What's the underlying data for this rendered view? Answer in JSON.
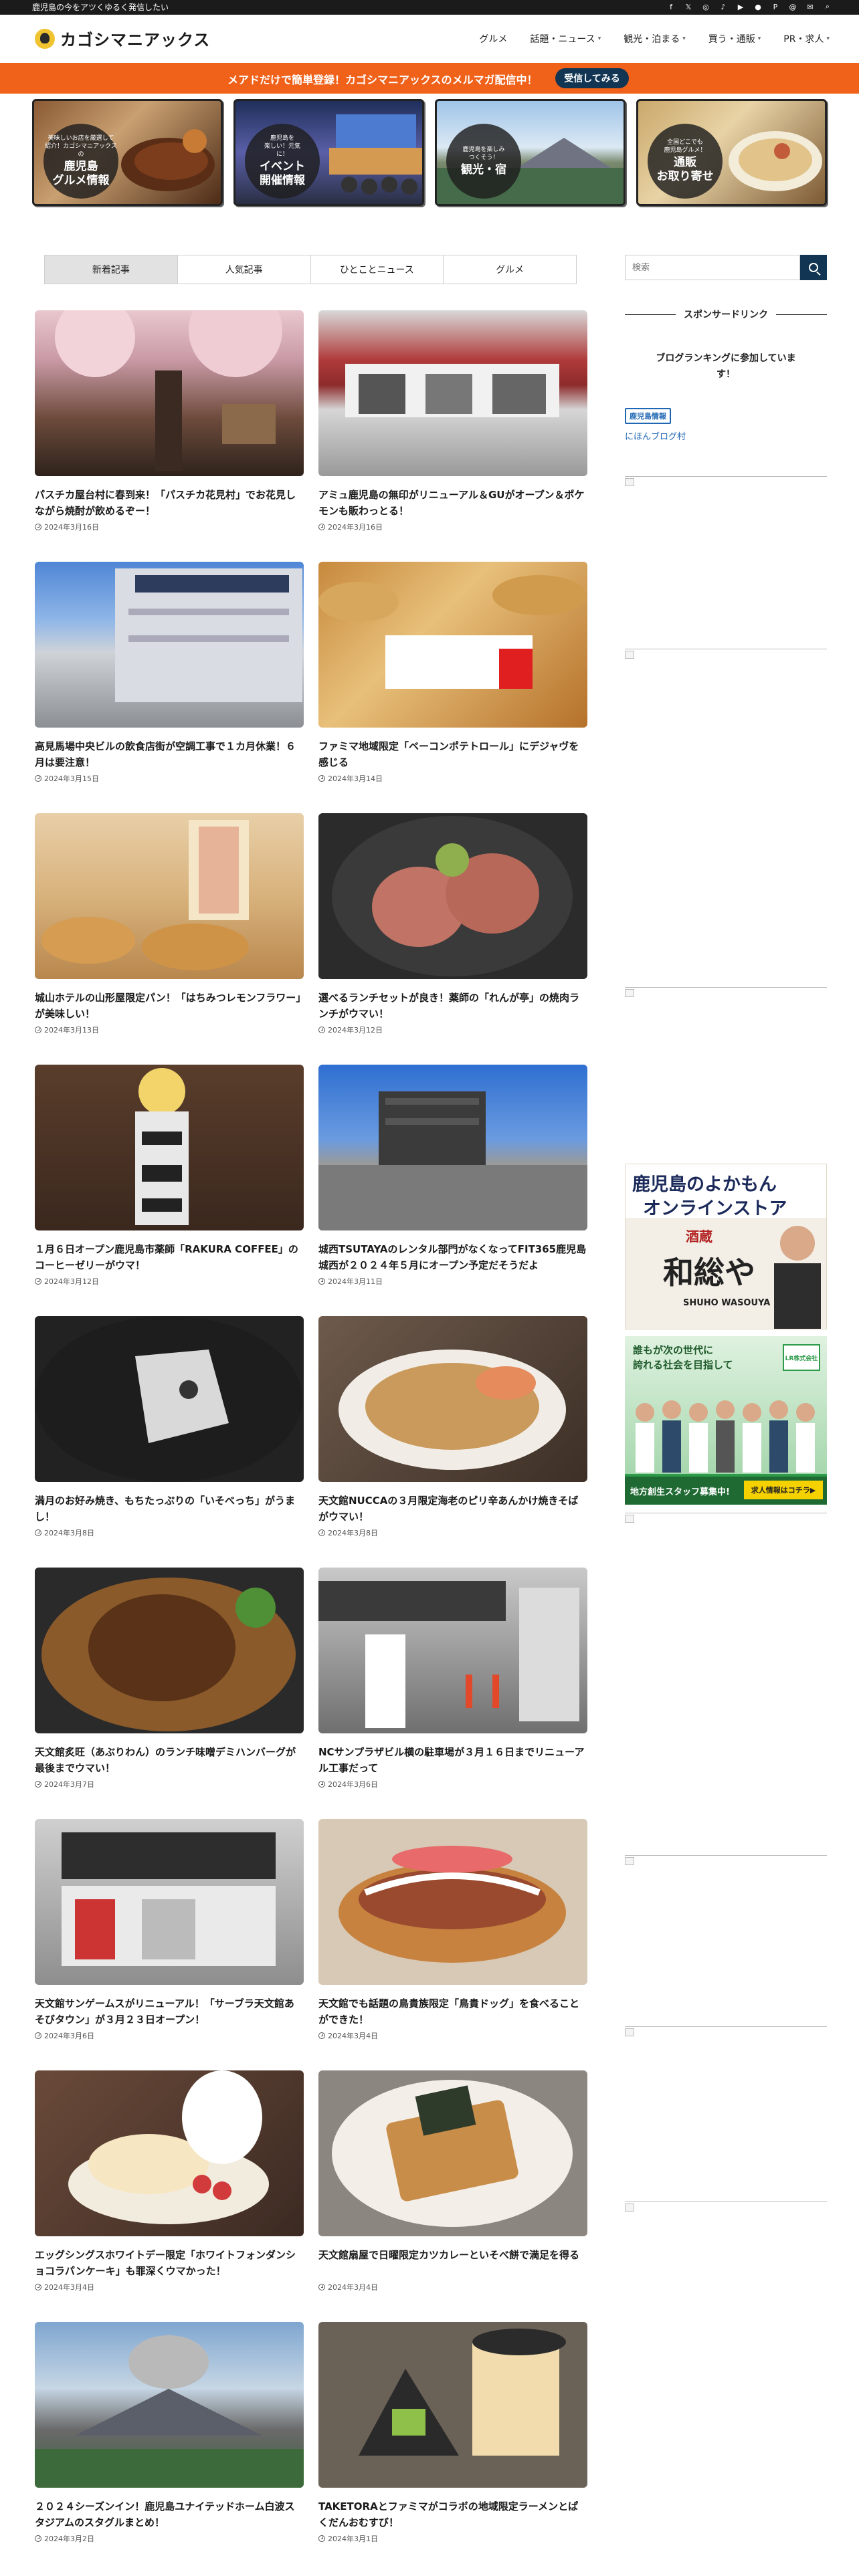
{
  "topbar": {
    "tagline": "鹿児島の今をアツくゆるく発信したい",
    "social_icons": [
      "facebook-icon",
      "x-icon",
      "instagram-icon",
      "tiktok-icon",
      "youtube-icon",
      "line-icon",
      "pinterest-icon",
      "threads-icon",
      "mail-icon",
      "search-icon"
    ]
  },
  "header": {
    "logo_text": "カゴシマニアックス",
    "nav": [
      {
        "label": "グルメ",
        "dropdown": false
      },
      {
        "label": "話題・ニュース",
        "dropdown": true
      },
      {
        "label": "観光・泊まる",
        "dropdown": true
      },
      {
        "label": "買う・通販",
        "dropdown": true
      },
      {
        "label": "PR・求人",
        "dropdown": true
      }
    ]
  },
  "promo": {
    "text": "メアドだけで簡単登録！カゴシマニアックスのメルマガ配信中！",
    "button": "受信してみる",
    "color": "#f0611a"
  },
  "banners": [
    {
      "small": "美味しいお店を厳選して\n紹介！カゴシマニアックスの",
      "big": "鹿児島\nグルメ情報"
    },
    {
      "small": "鹿児島を\n楽しい！元気\nに！",
      "big": "イベント\n開催情報"
    },
    {
      "small": "鹿児島を楽しみ\nつくそう！",
      "big": "観光・宿"
    },
    {
      "small": "全国どこでも\n鹿児島グルメ！",
      "big": "通販\nお取り寄せ"
    }
  ],
  "tabs": [
    "新着記事",
    "人気記事",
    "ひとことニュース",
    "グルメ"
  ],
  "posts": [
    {
      "title": "パスチカ屋台村に春到来！「パスチカ花見村」でお花見しながら焼酎が飲めるぞー！",
      "date": "2024年3月16日"
    },
    {
      "title": "アミュ鹿児島の無印がリニューアル＆GUがオープン＆ポケモンも販わっとる！",
      "date": "2024年3月16日"
    },
    {
      "title": "高見馬場中央ビルの飲食店街が空調工事で１カ月休業！６月は要注意！",
      "date": "2024年3月15日"
    },
    {
      "title": "ファミマ地域限定「ベーコンポテトロール」にデジャヴを感じる",
      "date": "2024年3月14日"
    },
    {
      "title": "城山ホテルの山形屋限定パン！「はちみつレモンフラワー」が美味しい！",
      "date": "2024年3月13日"
    },
    {
      "title": "選べるランチセットが良き！薬師の「れんが亭」の焼肉ランチがウマい！",
      "date": "2024年3月12日"
    },
    {
      "title": "１月６日オープン鹿児島市薬師「RAKURA COFFEE」のコーヒーゼリーがウマ！",
      "date": "2024年3月12日"
    },
    {
      "title": "城西TSUTAYAのレンタル部門がなくなってFIT365鹿児島城西が２０２４年５月にオープン予定だそうだよ",
      "date": "2024年3月11日"
    },
    {
      "title": "満月のお好み焼き、もちたっぷりの「いそべっち」がうまし！",
      "date": "2024年3月8日"
    },
    {
      "title": "天文館NUCCAの３月限定海老のピリ辛あんかけ焼きそばがウマい！",
      "date": "2024年3月8日"
    },
    {
      "title": "天文館炙旺（あぶりわん）のランチ味噌デミハンバーグが最後までウマい！",
      "date": "2024年3月7日"
    },
    {
      "title": "NCサンプラザビル横の駐車場が３月１６日までリニューアル工事だって",
      "date": "2024年3月6日"
    },
    {
      "title": "天文館サンゲームスがリニューアル！「サーブラ天文館あそびタウン」が３月２３日オープン！",
      "date": "2024年3月6日"
    },
    {
      "title": "天文館でも話題の鳥貴族限定「鳥貴ドッグ」を食べることができた！",
      "date": "2024年3月4日"
    },
    {
      "title": "エッグシングスホワイトデー限定「ホワイトフォンダンショコラパンケーキ」も罪深くウマかった！",
      "date": "2024年3月4日"
    },
    {
      "title": "天文館扇屋で日曜限定カツカレーといそべ餅で満足を得る",
      "date": "2024年3月4日"
    },
    {
      "title": "２０２４シーズンイン！鹿児島ユナイテッドホーム白波スタジアムのスタグルまとめ！",
      "date": "2024年3月2日"
    },
    {
      "title": "TAKETORAとファミマがコラボの地域限定ラーメンとぱくだんおむすび！",
      "date": "2024年3月1日"
    }
  ],
  "sidebar": {
    "search_placeholder": "検索",
    "sponsored_heading": "スポンサードリンク",
    "ranking_text": "ブログランキングに参加しています！",
    "blog_badge": "鹿児島情報",
    "blog_link": "にほんブログ村",
    "ad1": {
      "line1": "鹿児島のよかもん",
      "line2": "オンラインストア",
      "sub": "酒蔵",
      "name": "和総や",
      "brand": "SHUHO WASOUYA"
    },
    "ad2": {
      "line1": "誰もが次の世代に",
      "line2": "誇れる社会を目指して",
      "company": "LR株式会社",
      "footer": "地方創生スタッフ募集中!",
      "cta": "求人情報はコチラ▶"
    }
  },
  "colors": {
    "accent_navy": "#123553",
    "topbar": "#1b1b1b",
    "link": "#1f66b3"
  }
}
